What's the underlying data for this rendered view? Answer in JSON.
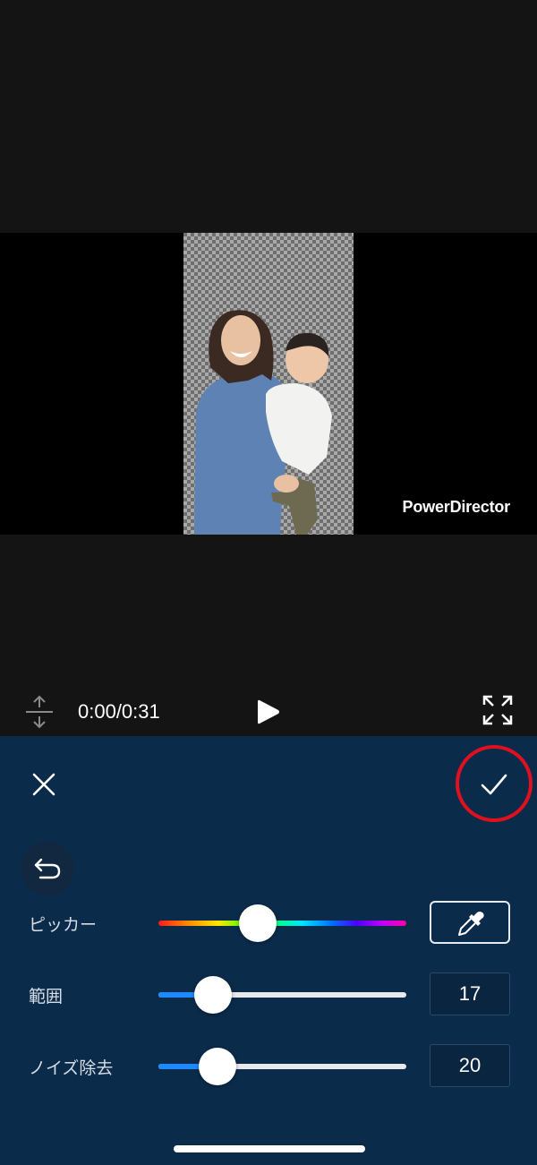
{
  "preview": {
    "watermark": "PowerDirector"
  },
  "playback": {
    "timecode": "0:00/0:31",
    "icons": [
      "split-vertical-icon",
      "play-icon",
      "fullscreen-icon"
    ]
  },
  "panel": {
    "icons": [
      "close-icon",
      "checkmark-icon",
      "undo-icon",
      "eyedropper-icon"
    ],
    "highlight_color": "#e0101e",
    "accent_color": "#1e88ff",
    "background_color": "#0b2b4b",
    "sliders": [
      {
        "id": "picker",
        "label": "ピッカー",
        "fraction": 0.4
      },
      {
        "id": "range",
        "label": "範囲",
        "fraction": 0.22,
        "value": "17"
      },
      {
        "id": "noise",
        "label": "ノイズ除去",
        "fraction": 0.24,
        "value": "20"
      }
    ]
  }
}
